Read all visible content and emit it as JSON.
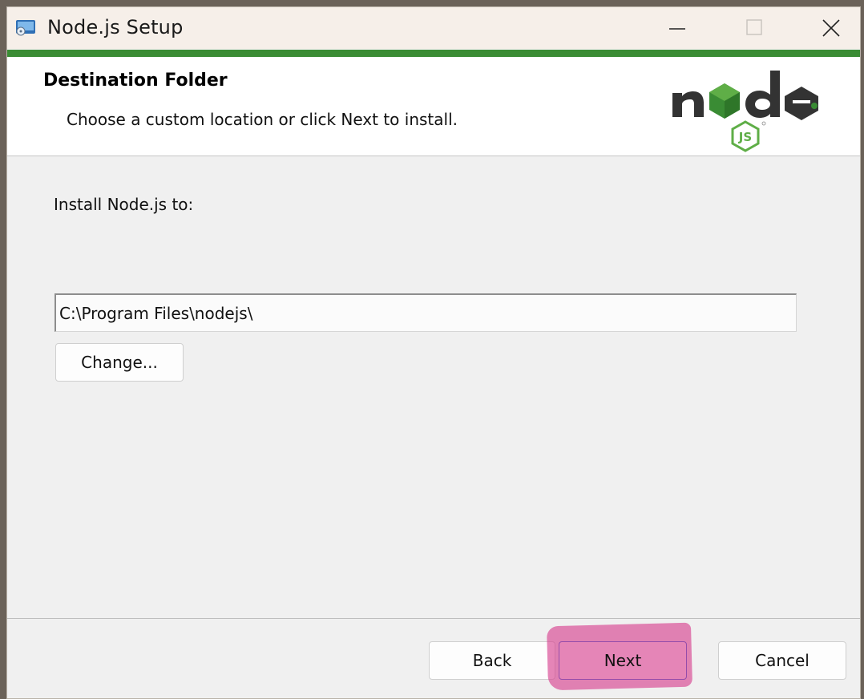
{
  "window": {
    "title": "Node.js Setup"
  },
  "header": {
    "title": "Destination Folder",
    "subtitle": "Choose a custom location or click Next to install.",
    "logo_icon": "nodejs-logo",
    "accent_color": "#3a8c34"
  },
  "main": {
    "install_label": "Install Node.js to:",
    "path_value": "C:\\Program Files\\nodejs\\",
    "change_label": "Change..."
  },
  "footer": {
    "back_label": "Back",
    "next_label": "Next",
    "cancel_label": "Cancel",
    "highlight_color": "#d63c8c"
  },
  "icons": {
    "minimize": "minimize-icon",
    "maximize": "maximize-icon",
    "close": "close-icon"
  }
}
